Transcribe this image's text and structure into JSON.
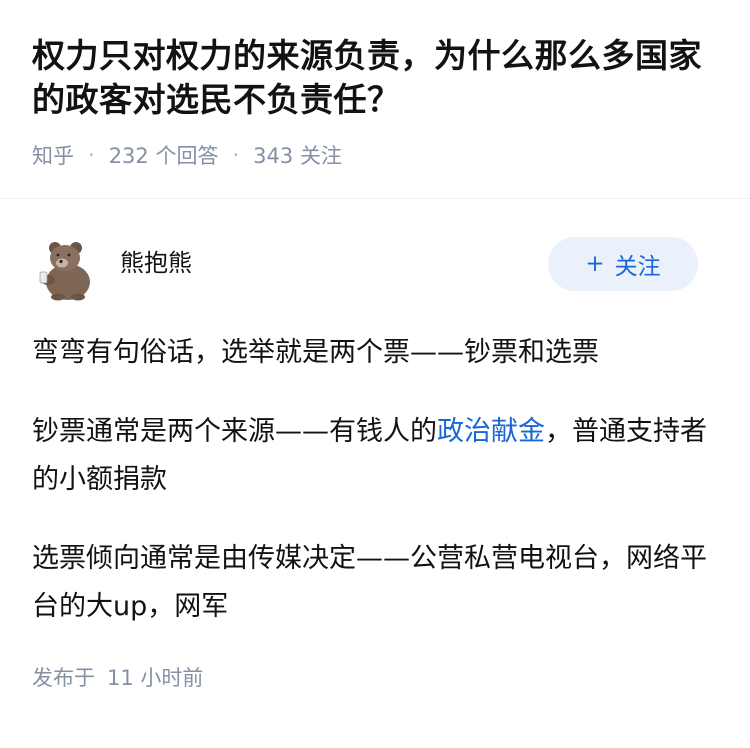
{
  "question": {
    "title": "权力只对权力的来源负责，为什么那么多国家的政客对选民不负责任？",
    "source": "知乎",
    "answers_count": "232",
    "answers_label": "个回答",
    "followers_count": "343",
    "followers_label": "关注"
  },
  "author": {
    "name": "熊抱熊",
    "avatar_icon": "bear-avatar-icon",
    "follow_plus": "+",
    "follow_label": "关注"
  },
  "content": {
    "p1": "弯弯有句俗话，选举就是两个票——钞票和选票",
    "p2_before": "钞票通常是两个来源——有钱人的",
    "p2_link": "政治献金",
    "p2_after": "，普通支持者的小额捐款",
    "p3": "选票倾向通常是由传媒决定——公营私营电视台，网络平台的大up，网军"
  },
  "footer": {
    "published_label": "发布于",
    "published_time": "11 小时前"
  },
  "colors": {
    "accent": "#1a66d6",
    "meta": "#8590a6",
    "button_bg": "#eaf1fb"
  }
}
